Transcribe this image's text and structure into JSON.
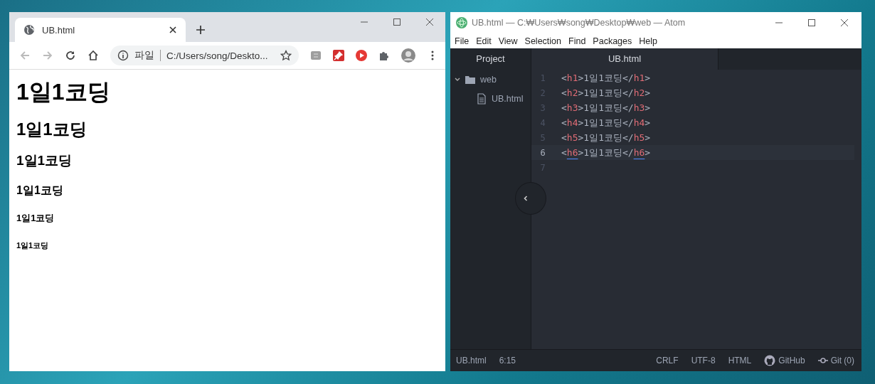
{
  "browser": {
    "tab": {
      "title": "UB.html",
      "selected": true
    },
    "address": {
      "scheme_label": "파일",
      "url": "C:/Users/song/Deskto..."
    },
    "headings": [
      {
        "kind": "h1",
        "text": "1일1코딩"
      },
      {
        "kind": "h2",
        "text": "1일1코딩"
      },
      {
        "kind": "h3",
        "text": "1일1코딩"
      },
      {
        "kind": "h4",
        "text": "1일1코딩"
      },
      {
        "kind": "h5",
        "text": "1일1코딩"
      },
      {
        "kind": "h6",
        "text": "1일1코딩"
      }
    ]
  },
  "editor": {
    "window": {
      "title": "UB.html — C:₩Users₩song₩Desktop₩web — Atom"
    },
    "menu": [
      "File",
      "Edit",
      "View",
      "Selection",
      "Find",
      "Packages",
      "Help"
    ],
    "panel_tab": "Project",
    "file_tab": {
      "title": "UB.html",
      "selected": true
    },
    "tree": [
      {
        "name": "web",
        "expanded": true,
        "children": [
          {
            "name": "UB.html"
          }
        ]
      }
    ],
    "lines": [
      {
        "number": "1",
        "current": false,
        "tokens": [
          {
            "kind": "punct",
            "text": "<"
          },
          {
            "kind": "tag",
            "text": "h1"
          },
          {
            "kind": "punct",
            "text": ">"
          },
          {
            "kind": "text",
            "text": "1일1코딩"
          },
          {
            "kind": "punct",
            "text": "</"
          },
          {
            "kind": "tag",
            "text": "h1"
          },
          {
            "kind": "punct",
            "text": ">"
          }
        ]
      },
      {
        "number": "2",
        "current": false,
        "tokens": [
          {
            "kind": "punct",
            "text": "<"
          },
          {
            "kind": "tag",
            "text": "h2"
          },
          {
            "kind": "punct",
            "text": ">"
          },
          {
            "kind": "text",
            "text": "1일1코딩"
          },
          {
            "kind": "punct",
            "text": "</"
          },
          {
            "kind": "tag",
            "text": "h2"
          },
          {
            "kind": "punct",
            "text": ">"
          }
        ]
      },
      {
        "number": "3",
        "current": false,
        "tokens": [
          {
            "kind": "punct",
            "text": "<"
          },
          {
            "kind": "tag",
            "text": "h3"
          },
          {
            "kind": "punct",
            "text": ">"
          },
          {
            "kind": "text",
            "text": "1일1코딩"
          },
          {
            "kind": "punct",
            "text": "</"
          },
          {
            "kind": "tag",
            "text": "h3"
          },
          {
            "kind": "punct",
            "text": ">"
          }
        ]
      },
      {
        "number": "4",
        "current": false,
        "tokens": [
          {
            "kind": "punct",
            "text": "<"
          },
          {
            "kind": "tag",
            "text": "h4"
          },
          {
            "kind": "punct",
            "text": ">"
          },
          {
            "kind": "text",
            "text": "1일1코딩"
          },
          {
            "kind": "punct",
            "text": "</"
          },
          {
            "kind": "tag",
            "text": "h4"
          },
          {
            "kind": "punct",
            "text": ">"
          }
        ]
      },
      {
        "number": "5",
        "current": false,
        "tokens": [
          {
            "kind": "punct",
            "text": "<"
          },
          {
            "kind": "tag",
            "text": "h5"
          },
          {
            "kind": "punct",
            "text": ">"
          },
          {
            "kind": "text",
            "text": "1일1코딩"
          },
          {
            "kind": "punct",
            "text": "</"
          },
          {
            "kind": "tag",
            "text": "h5"
          },
          {
            "kind": "punct",
            "text": ">"
          }
        ]
      },
      {
        "number": "6",
        "current": true,
        "tokens": [
          {
            "kind": "punct",
            "text": "<"
          },
          {
            "kind": "matched",
            "text": "h6"
          },
          {
            "kind": "punct",
            "text": ">"
          },
          {
            "kind": "text",
            "text": "1일1코딩"
          },
          {
            "kind": "punct",
            "text": "</"
          },
          {
            "kind": "matched",
            "text": "h6"
          },
          {
            "kind": "punct",
            "text": ">"
          }
        ]
      },
      {
        "number": "7",
        "current": false
      }
    ],
    "status_bar": {
      "file": "UB.html",
      "cursor": "6:15",
      "line_ending": "CRLF",
      "encoding": "UTF-8",
      "grammar": "HTML",
      "github": "GitHub",
      "git": "Git (0)"
    }
  }
}
